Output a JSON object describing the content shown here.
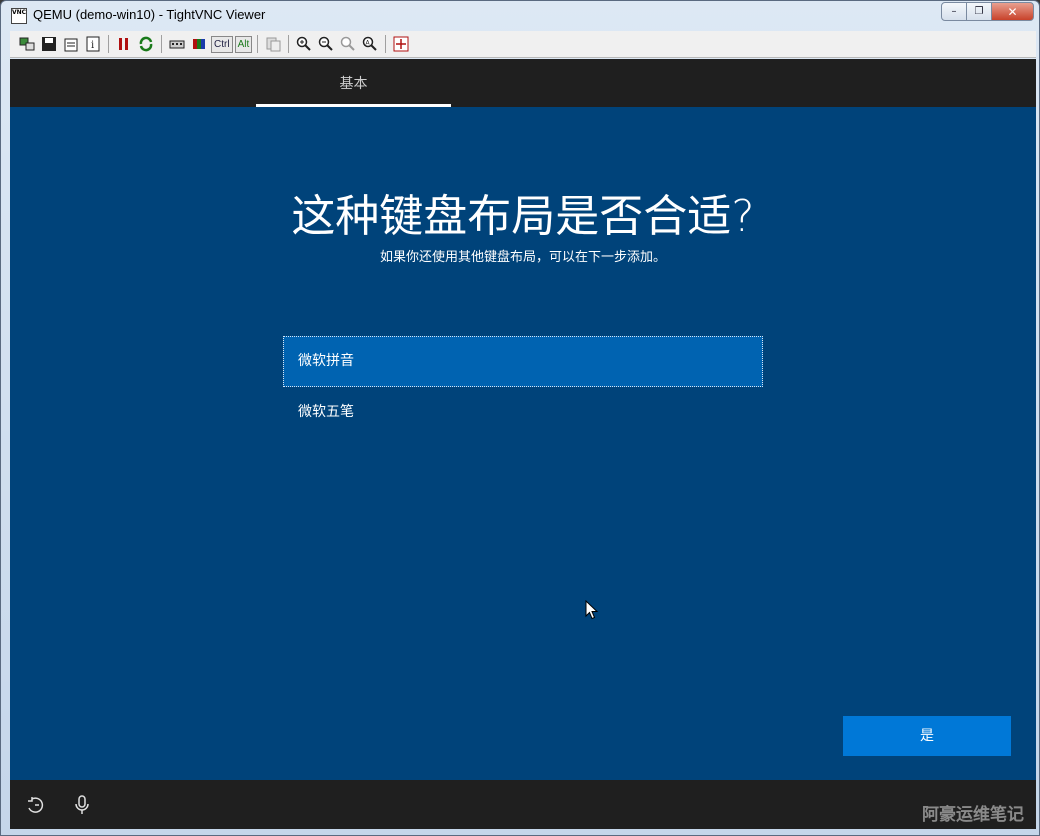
{
  "window": {
    "title": "QEMU (demo-win10) - TightVNC Viewer",
    "icon_text": "VNC",
    "minimize": "–",
    "restore": "❐",
    "close": "✕"
  },
  "toolbar": {
    "ctrl_label": "Ctrl",
    "alt_label": "Alt",
    "icons": [
      "new-connection-icon",
      "save-icon",
      "options-icon",
      "info-icon",
      "pause-icon",
      "refresh-icon",
      "send-keys-icon",
      "ctrl-alt-del-icon",
      "ctrl-key",
      "alt-key",
      "clipboard-icon",
      "zoom-in-icon",
      "zoom-out-icon",
      "zoom-100-icon",
      "zoom-auto-icon",
      "fullscreen-icon"
    ]
  },
  "oobe": {
    "tab_label": "基本",
    "heading": "这种键盘布局是否合适?",
    "subheading": "如果你还使用其他键盘布局，可以在下一步添加。",
    "options": [
      {
        "label": "微软拼音",
        "selected": true
      },
      {
        "label": "微软五笔",
        "selected": false
      }
    ],
    "yes_button": "是",
    "watermark": "阿豪运维笔记",
    "colors": {
      "background": "#00437a",
      "selected_item": "#0063b1",
      "primary_button": "#0078d7",
      "bars": "#1f1f1f"
    }
  }
}
